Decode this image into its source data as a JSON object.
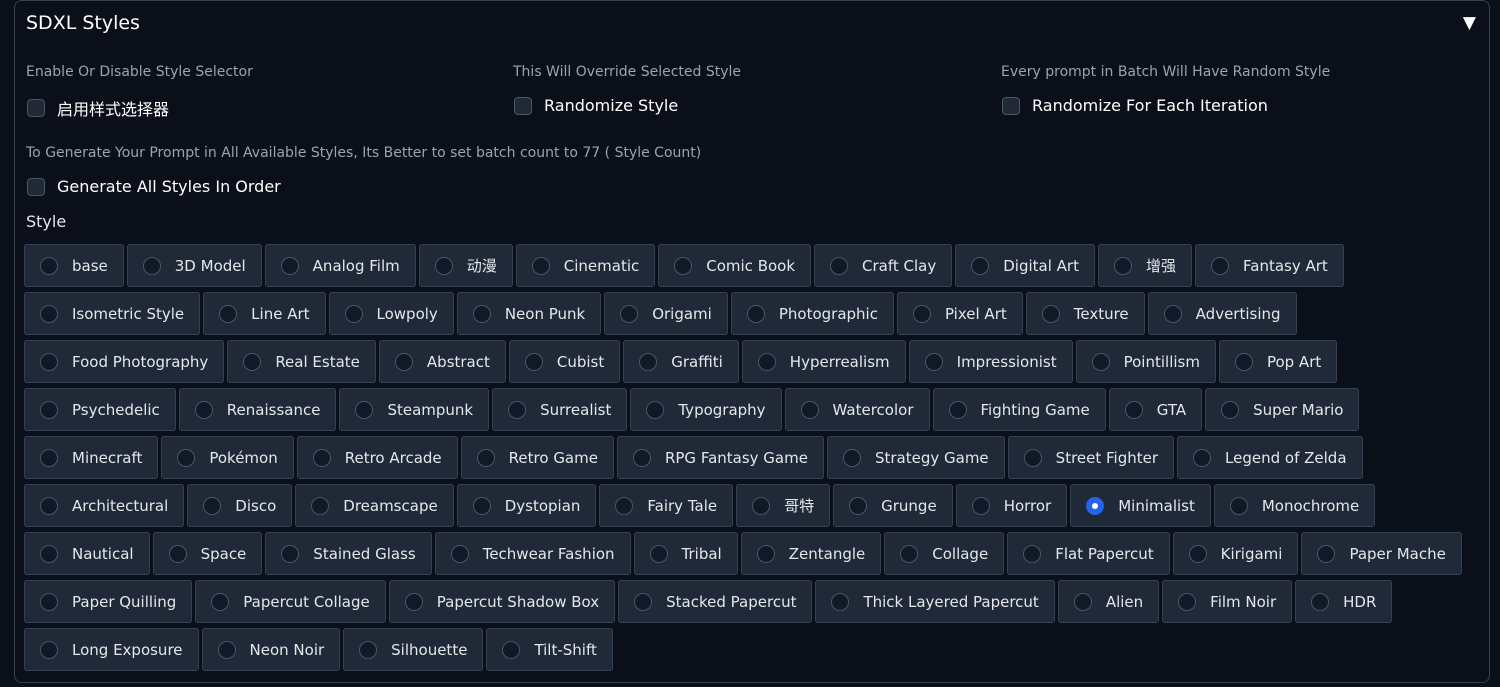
{
  "panel": {
    "title": "SDXL Styles",
    "collapse_icon": "▼"
  },
  "options": {
    "enable": {
      "info": "Enable Or Disable Style Selector",
      "label": "启用样式选择器",
      "checked": false
    },
    "randomize": {
      "info": "This Will Override Selected Style",
      "label": "Randomize Style",
      "checked": false
    },
    "randomize_each": {
      "info": "Every prompt in Batch Will Have Random Style",
      "label": "Randomize For Each Iteration",
      "checked": false
    },
    "all_styles": {
      "info": "To Generate Your Prompt in All Available Styles, Its Better to set batch count to 77 ( Style Count)",
      "label": "Generate All Styles In Order",
      "checked": false
    }
  },
  "style": {
    "label": "Style",
    "selected": "Minimalist",
    "accent_color": "#2563eb",
    "options": [
      "base",
      "3D Model",
      "Analog Film",
      "动漫",
      "Cinematic",
      "Comic Book",
      "Craft Clay",
      "Digital Art",
      "增强",
      "Fantasy Art",
      "Isometric Style",
      "Line Art",
      "Lowpoly",
      "Neon Punk",
      "Origami",
      "Photographic",
      "Pixel Art",
      "Texture",
      "Advertising",
      "Food Photography",
      "Real Estate",
      "Abstract",
      "Cubist",
      "Graffiti",
      "Hyperrealism",
      "Impressionist",
      "Pointillism",
      "Pop Art",
      "Psychedelic",
      "Renaissance",
      "Steampunk",
      "Surrealist",
      "Typography",
      "Watercolor",
      "Fighting Game",
      "GTA",
      "Super Mario",
      "Minecraft",
      "Pokémon",
      "Retro Arcade",
      "Retro Game",
      "RPG Fantasy Game",
      "Strategy Game",
      "Street Fighter",
      "Legend of Zelda",
      "Architectural",
      "Disco",
      "Dreamscape",
      "Dystopian",
      "Fairy Tale",
      "哥特",
      "Grunge",
      "Horror",
      "Minimalist",
      "Monochrome",
      "Nautical",
      "Space",
      "Stained Glass",
      "Techwear Fashion",
      "Tribal",
      "Zentangle",
      "Collage",
      "Flat Papercut",
      "Kirigami",
      "Paper Mache",
      "Paper Quilling",
      "Papercut Collage",
      "Papercut Shadow Box",
      "Stacked Papercut",
      "Thick Layered Papercut",
      "Alien",
      "Film Noir",
      "HDR",
      "Long Exposure",
      "Neon Noir",
      "Silhouette",
      "Tilt-Shift"
    ]
  }
}
